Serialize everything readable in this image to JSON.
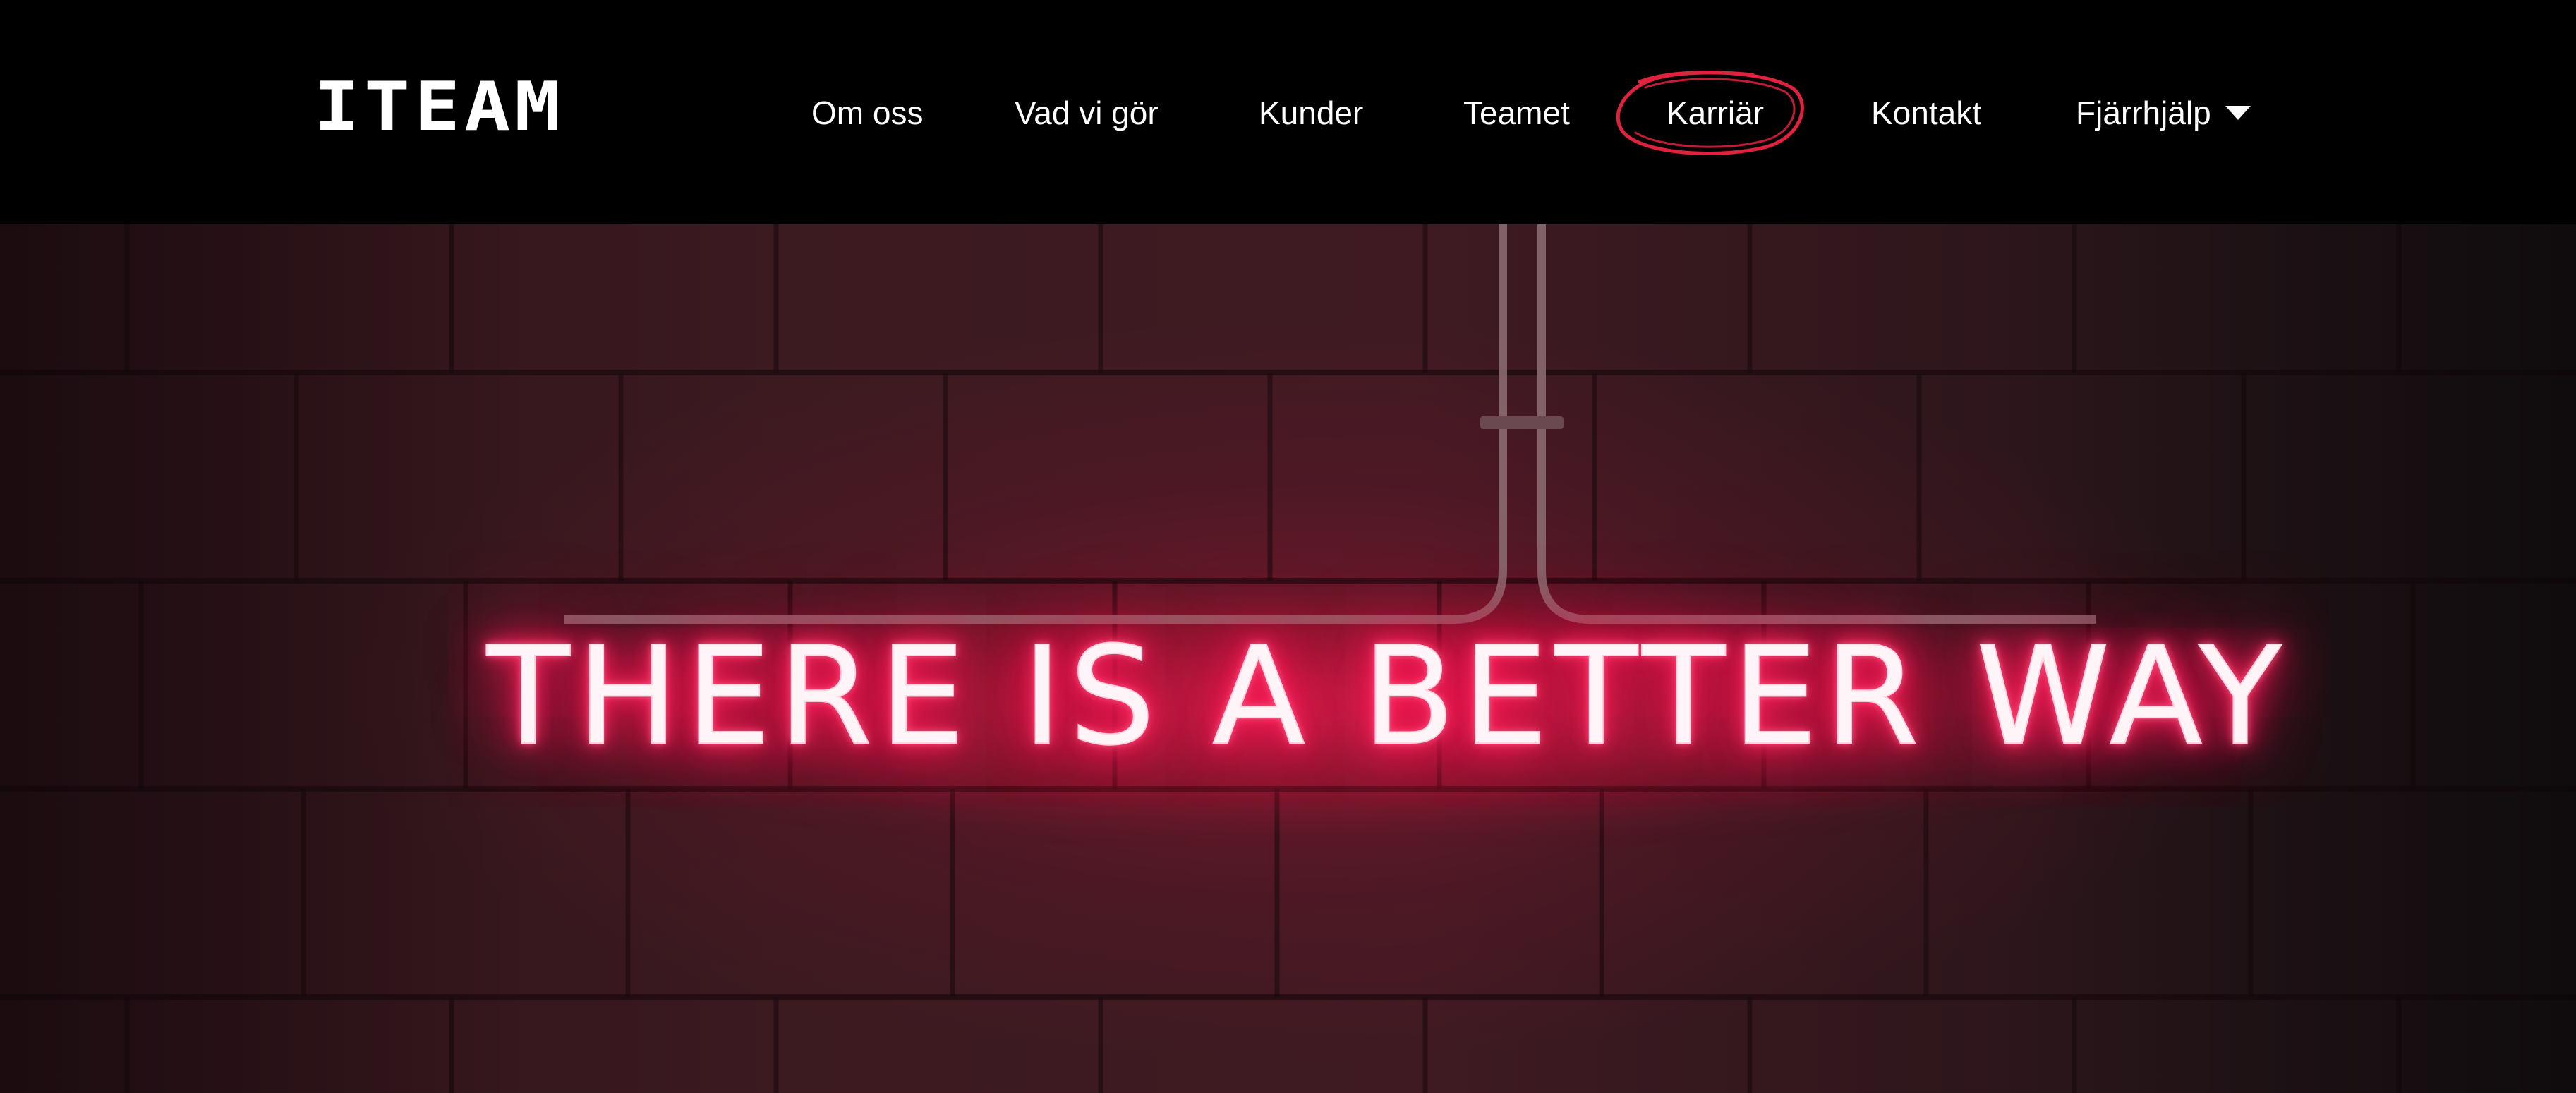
{
  "header": {
    "logo_text": "ITEAM",
    "nav": [
      {
        "label": "Om oss"
      },
      {
        "label": "Vad vi gör"
      },
      {
        "label": "Kunder"
      },
      {
        "label": "Teamet"
      },
      {
        "label": "Karriär"
      },
      {
        "label": "Kontakt"
      },
      {
        "label": "Fjärrhjälp"
      }
    ],
    "highlighted_item": "Karriär",
    "dropdown_icon": "caret-down-icon"
  },
  "hero": {
    "neon_sign_text": "THERE IS A BETTER WAY"
  },
  "colors": {
    "header_background": "#000000",
    "nav_text": "#ffffff",
    "highlight_circle": "#e0223f",
    "neon": "#ff1a58",
    "wall": "#3b1a20"
  }
}
